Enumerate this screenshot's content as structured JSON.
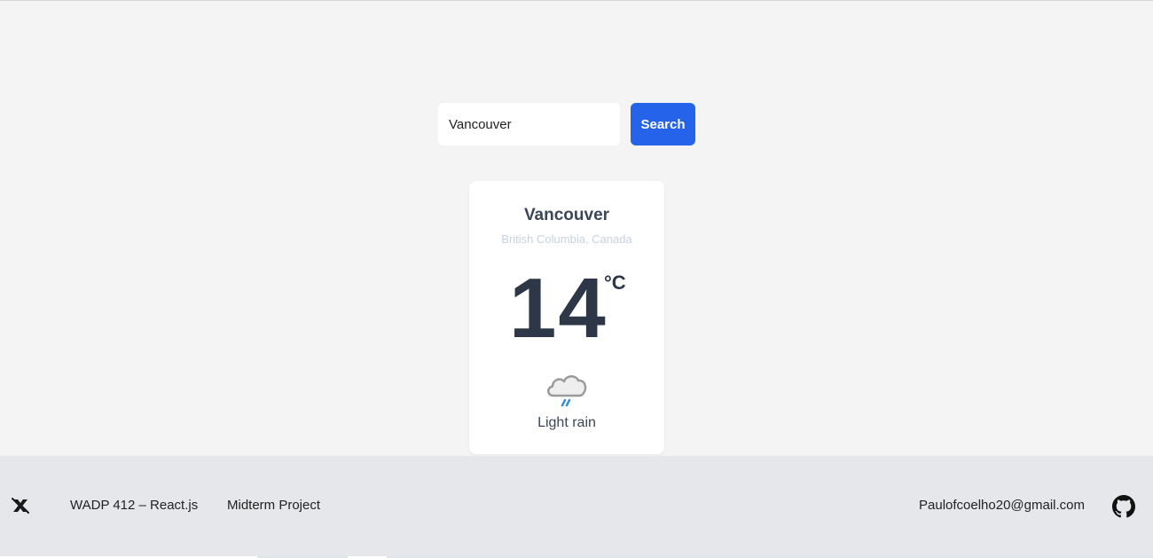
{
  "search": {
    "value": "Vancouver",
    "button_label": "Search"
  },
  "weather": {
    "city": "Vancouver",
    "region": "British Columbia, Canada",
    "temperature": "14",
    "unit": "°C",
    "condition": "Light rain",
    "icon": "light-rain-icon"
  },
  "footer": {
    "logo_icon": "x-logo-icon",
    "course": "WADP 412 – React.js",
    "project": "Midterm Project",
    "email": "Paulofcoelho20@gmail.com",
    "github_icon": "github-icon"
  },
  "colors": {
    "background": "#f4f4f4",
    "accent": "#2563eb",
    "footer_background": "#e5e7eb",
    "text_dark": "#2d3748",
    "region_text": "#c7d2e0"
  }
}
